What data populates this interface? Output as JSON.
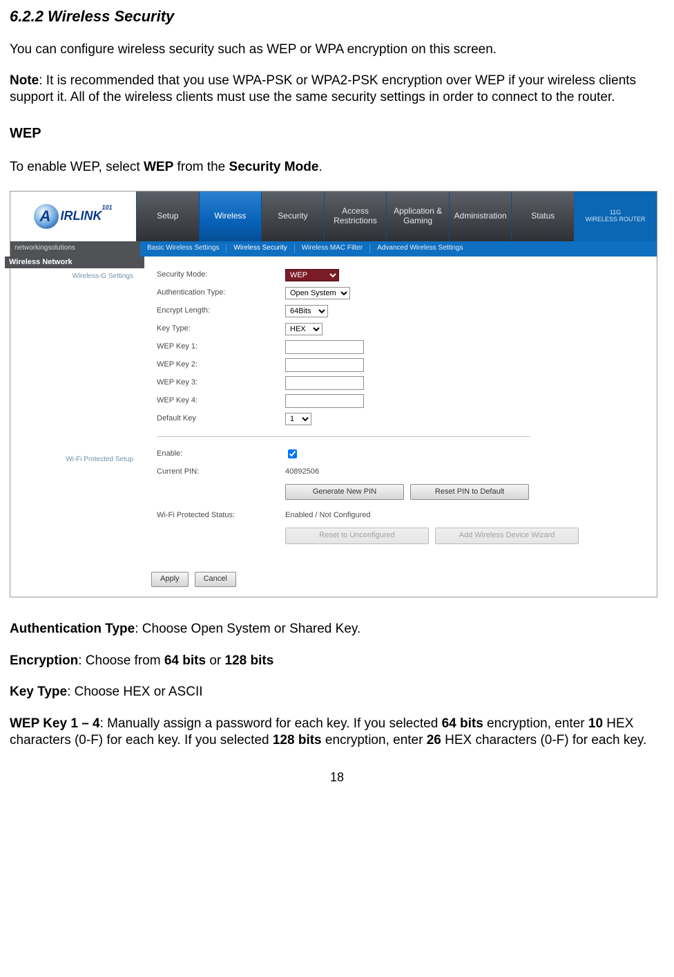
{
  "doc": {
    "section_title": "6.2.2 Wireless Security",
    "intro": "You can configure wireless security such as WEP or WPA encryption on this screen.",
    "note_label": "Note",
    "note_text": ": It is recommended that you use WPA-PSK or WPA2-PSK encryption over WEP if your wireless clients support it. All of the wireless clients must use the same security settings in order to connect to the router.",
    "wep_heading": "WEP",
    "wep_enable_pre": "To enable WEP, select ",
    "wep_enable_mid": "WEP",
    "wep_enable_mid2": " from the ",
    "wep_enable_bold2": "Security Mode",
    "wep_enable_end": ".",
    "auth_label": "Authentication Type",
    "auth_text": ": Choose Open System or Shared Key.",
    "enc_label": "Encryption",
    "enc_text1": ": Choose from ",
    "enc_b1": "64 bits",
    "enc_or": " or ",
    "enc_b2": "128 bits",
    "key_label": "Key Type",
    "key_text": ": Choose HEX or ASCII",
    "wk_label": "WEP Key 1 – 4",
    "wk_t1": ": Manually assign a password for each key. If you selected ",
    "wk_b1": "64 bits",
    "wk_t2": " encryption, enter ",
    "wk_b2": "10",
    "wk_t3": " HEX characters (0-F) for each key. If you selected ",
    "wk_b3": "128 bits",
    "wk_t4": " encryption, enter ",
    "wk_b4": "26",
    "wk_t5": " HEX characters (0-F) for each key.",
    "page_number": "18"
  },
  "ui": {
    "brand": "IRLINK",
    "brand_sub": "101",
    "tagline": "networkingsolutions",
    "corner1": "11G",
    "corner2": "WIRELESS ROUTER",
    "tabs": [
      "Setup",
      "Wireless",
      "Security",
      "Access Restrictions",
      "Application & Gaming",
      "Administration",
      "Status"
    ],
    "subtabs": [
      "Basic Wireless Settings",
      "Wireless Security",
      "Wireless MAC Filter",
      "Advanced Wireless Settings"
    ],
    "side_title": "Wireless Network",
    "side_label1": "Wireless-G Settings",
    "side_label2": "Wi-Fi Protected Setup",
    "form": {
      "security_mode_lbl": "Security Mode:",
      "security_mode_val": "WEP",
      "auth_type_lbl": "Authentication Type:",
      "auth_type_val": "Open System",
      "encrypt_len_lbl": "Encrypt Length:",
      "encrypt_len_val": "64Bits",
      "key_type_lbl": "Key Type:",
      "key_type_val": "HEX",
      "wep1": "WEP Key 1:",
      "wep2": "WEP Key 2:",
      "wep3": "WEP Key 3:",
      "wep4": "WEP Key 4:",
      "default_key_lbl": "Default Key",
      "default_key_val": "1",
      "enable_lbl": "Enable:",
      "pin_lbl": "Current PIN:",
      "pin_val": "40892506",
      "gen_pin": "Generate New PIN",
      "reset_pin": "Reset PIN to Default",
      "wps_status_lbl": "Wi-Fi Protected Status:",
      "wps_status_val": "Enabled / Not Configured",
      "reset_unconf": "Reset to Unconfigured",
      "add_wizard": "Add Wireless Device Wizard",
      "apply": "Apply",
      "cancel": "Cancel"
    }
  }
}
